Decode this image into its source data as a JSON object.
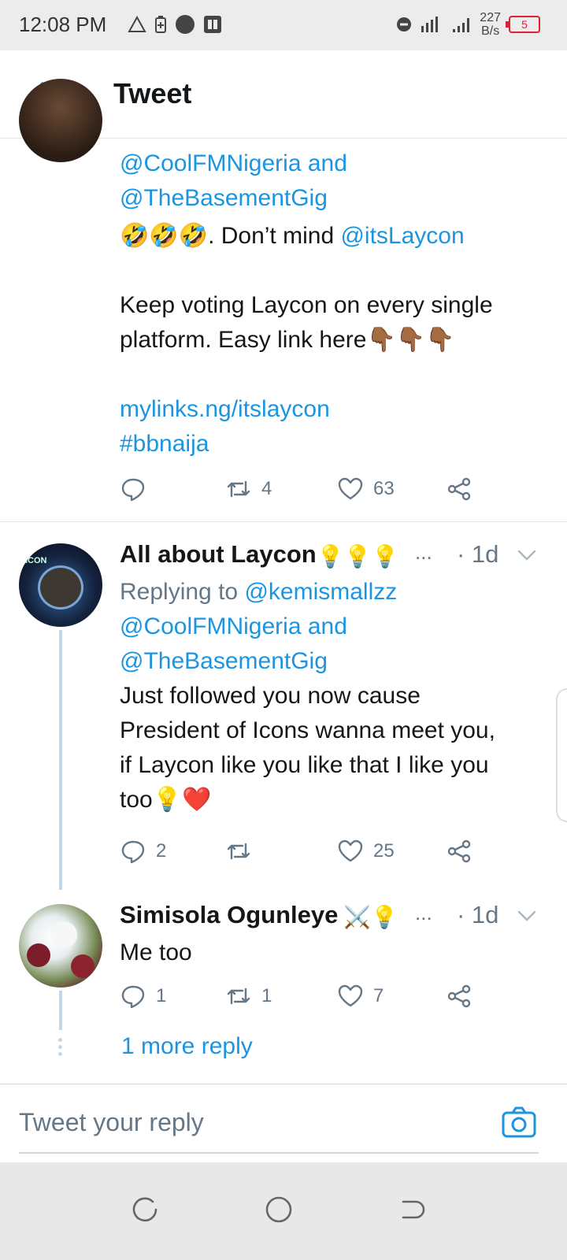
{
  "status_bar": {
    "time": "12:08 PM",
    "net_speed_value": "227",
    "net_speed_unit": "B/s",
    "battery_level": "5"
  },
  "header": {
    "title": "Tweet"
  },
  "tweets": [
    {
      "reply_to_line1": "@CoolFMNigeria and",
      "reply_to_line2": "@TheBasementGig",
      "text_emoji": "🤣🤣🤣",
      "text_part1": ". Don’t mind ",
      "mention": "@itsLaycon",
      "text_line2": "Keep voting Laycon on every single",
      "text_line3": "platform. Easy link here",
      "text_line3_emoji": "👇🏾👇🏾👇🏾",
      "link": "mylinks.ng/itslaycon",
      "hashtag": "#bbnaija",
      "replies": "",
      "retweets": "4",
      "likes": "63"
    },
    {
      "name": "All about Laycon",
      "name_emoji": "💡💡💡",
      "ellipsis": "...",
      "time": "· 1d",
      "replying_label": "Replying to ",
      "reply_to_user": "@kemismallzz",
      "reply_to_line2": "@CoolFMNigeria and",
      "reply_to_line3": "@TheBasementGig",
      "text_line1": "Just followed you now cause",
      "text_line2": "President of Icons wanna meet you,",
      "text_line3": "if Laycon like you like that I like you",
      "text_line4": "too",
      "text_line4_emoji": "💡❤️",
      "avatar_text": "ICON",
      "replies": "2",
      "retweets": "",
      "likes": "25"
    },
    {
      "name": "Simisola Ogunleye",
      "name_emoji": "⚔️💡",
      "ellipsis": "...",
      "time": "· 1d",
      "text": "Me too",
      "replies": "1",
      "retweets": "1",
      "likes": "7"
    }
  ],
  "more_reply": "1 more reply",
  "reply_bar": {
    "placeholder": "Tweet your reply"
  },
  "colors": {
    "link": "#1b95e0",
    "secondary": "#657786",
    "thread_line": "#c4d7e6"
  },
  "icons": [
    "back-arrow-icon",
    "reply-icon",
    "retweet-icon",
    "like-icon",
    "share-icon",
    "chevron-down-icon",
    "camera-icon"
  ]
}
